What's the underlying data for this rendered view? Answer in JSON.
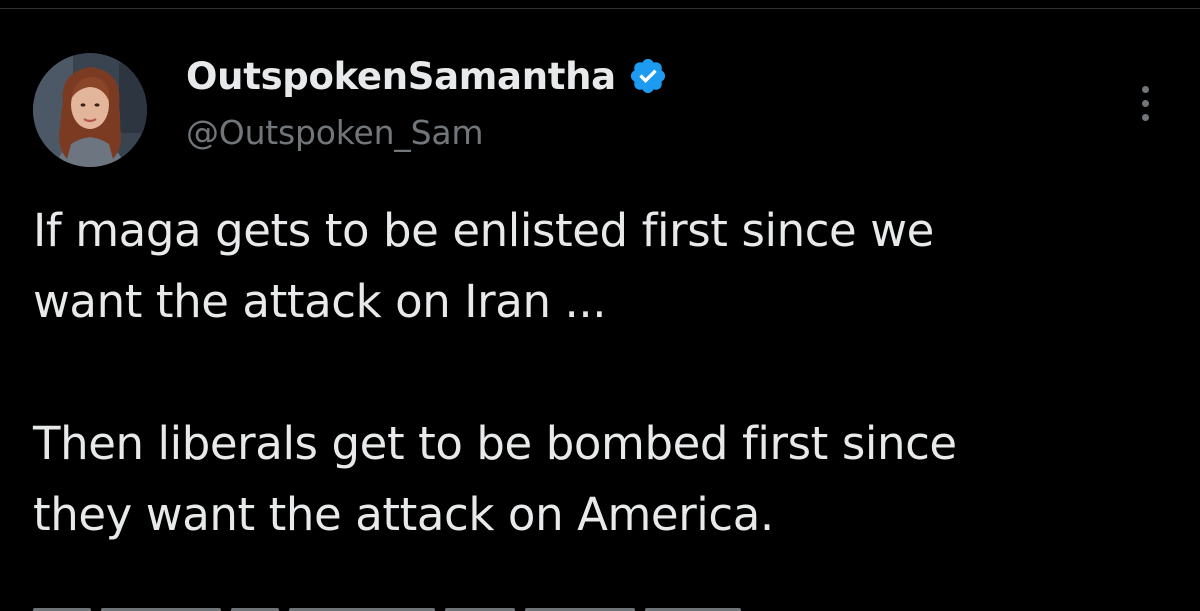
{
  "tweet": {
    "author": {
      "display_name": "OutspokenSamantha",
      "handle": "@Outspoken_Sam",
      "verified": true,
      "avatar_icon": "profile-photo"
    },
    "more_icon": "more-options-icon",
    "text": {
      "line1": "If maga gets to be enlisted first since we",
      "line2": "want the attack on Iran ...",
      "line3": "Then liberals get to be bombed first since",
      "line4": "they want the attack on America."
    }
  },
  "colors": {
    "background": "#000000",
    "text_primary": "#e7e9ea",
    "text_secondary": "#71767b",
    "verified_blue": "#1d9bf0",
    "divider": "#2f3336"
  }
}
